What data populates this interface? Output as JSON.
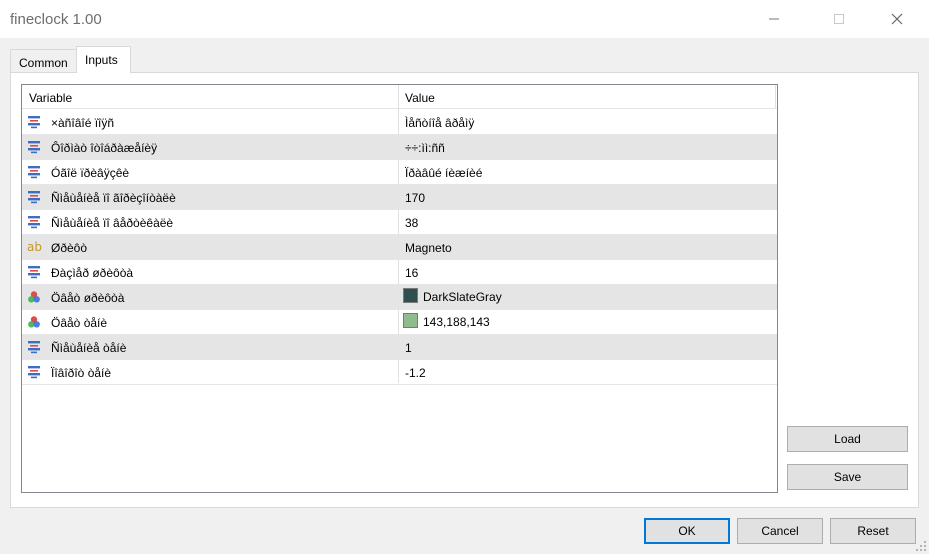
{
  "window": {
    "title": "fineclock 1.00",
    "minimize_glyph": "—",
    "maximize_glyph": "☐",
    "close_glyph": "✕"
  },
  "tabs": [
    {
      "label": "Common",
      "active": false
    },
    {
      "label": "Inputs",
      "active": true
    }
  ],
  "grid": {
    "headers": {
      "variable": "Variable",
      "value": "Value"
    },
    "rows": [
      {
        "icon": "numeric-icon",
        "variable": "×àñîâîé ïîÿñ",
        "value": "Ìåñòíîå âðåìÿ"
      },
      {
        "icon": "numeric-icon",
        "variable": "Ôîðìàò îòîáðàæåíèÿ",
        "value": "÷÷:ìì:ññ"
      },
      {
        "icon": "numeric-icon",
        "variable": "Óãîë ïðèâÿçêè",
        "value": "Ïðàâûé íèæíèé"
      },
      {
        "icon": "numeric-icon",
        "variable": "Ñìåùåíèå ïî ãîðèçîíòàëè",
        "value": "170"
      },
      {
        "icon": "numeric-icon",
        "variable": "Ñìåùåíèå ïî âåðòèêàëè",
        "value": "38"
      },
      {
        "icon": "text-icon",
        "variable": "Øðèôò",
        "value": "Magneto"
      },
      {
        "icon": "numeric-icon",
        "variable": "Ðàçìåð øðèôòà",
        "value": "16"
      },
      {
        "icon": "color-icon",
        "variable": "Öâåò øðèôòà",
        "value": "DarkSlateGray",
        "swatch": "#2f4f4f"
      },
      {
        "icon": "color-icon",
        "variable": "Öâåò òåíè",
        "value": "143,188,143",
        "swatch": "#8fbc8f"
      },
      {
        "icon": "numeric-icon",
        "variable": "Ñìåùåíèå òåíè",
        "value": "1"
      },
      {
        "icon": "numeric-icon",
        "variable": "Ïîâîðîò òåíè",
        "value": "-1.2"
      }
    ]
  },
  "buttons": {
    "load": "Load",
    "save": "Save",
    "ok": "OK",
    "cancel": "Cancel",
    "reset": "Reset"
  },
  "colors": {
    "accent": "#0078d7",
    "row_alt": "#e5e5e5",
    "icon_blue": "#3a6fc4",
    "icon_red": "#e04848"
  }
}
